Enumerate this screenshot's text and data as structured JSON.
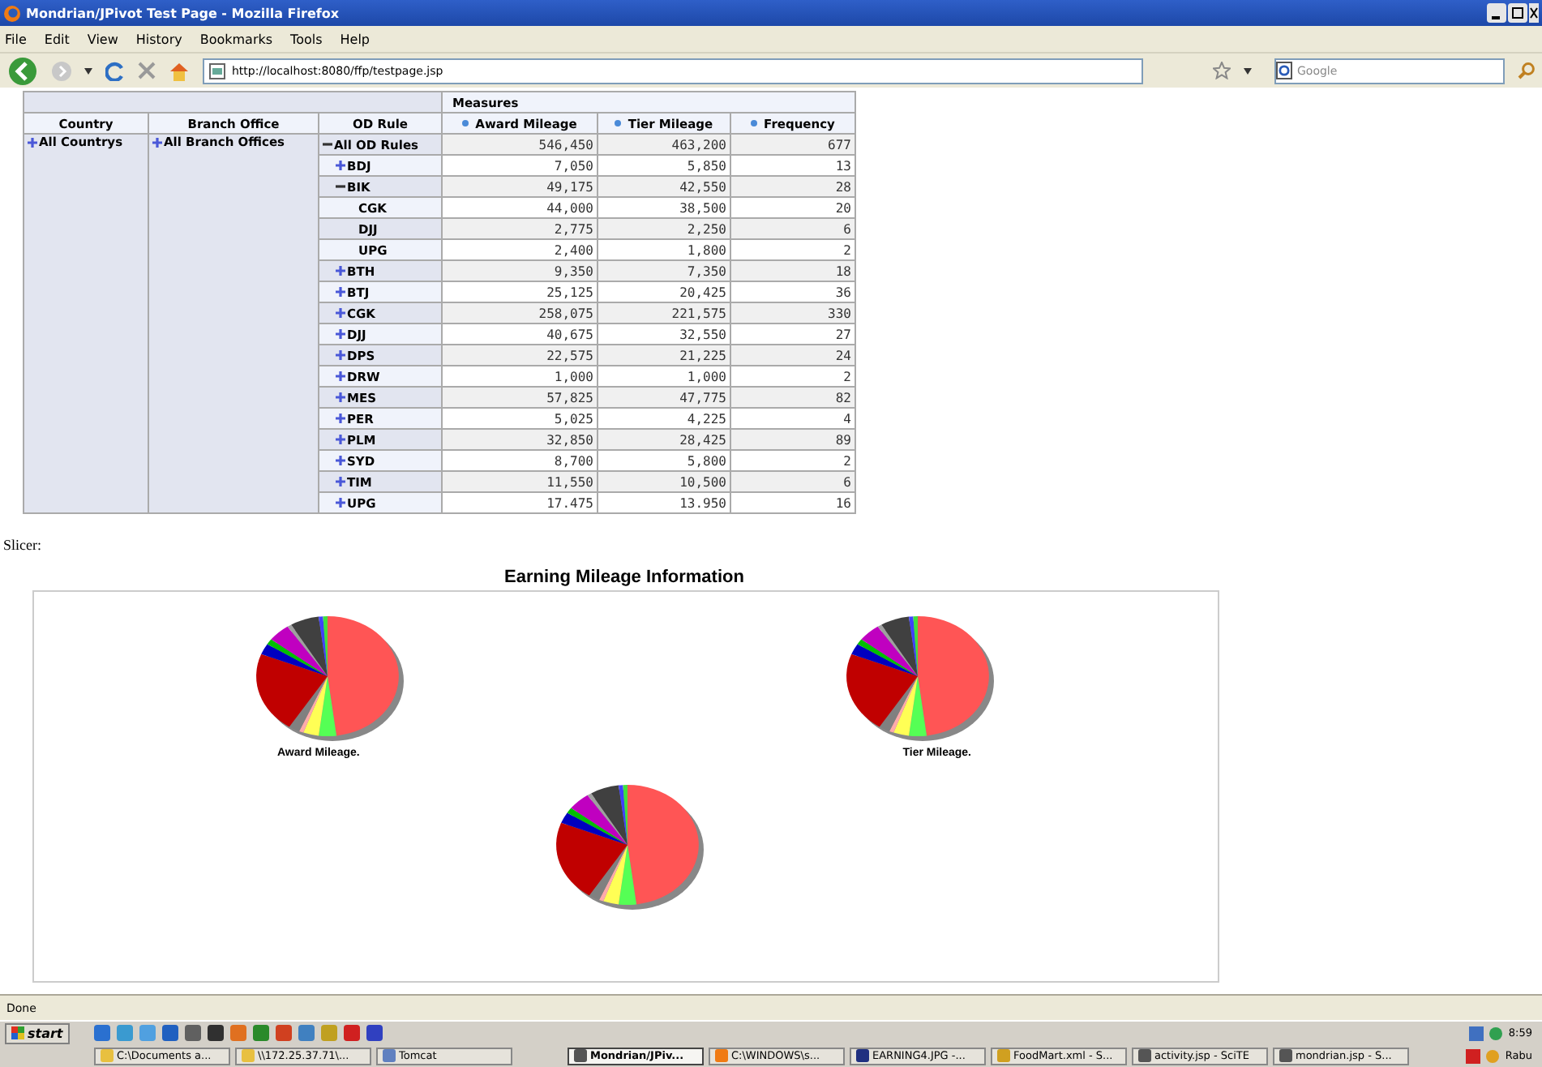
{
  "window": {
    "title": "Mondrian/JPivot Test Page - Mozilla Firefox"
  },
  "menu": [
    "File",
    "Edit",
    "View",
    "History",
    "Bookmarks",
    "Tools",
    "Help"
  ],
  "address_bar": {
    "value": "http://localhost:8080/ffp/testpage.jsp"
  },
  "search": {
    "placeholder": "Google"
  },
  "pivot": {
    "measures_label": "Measures",
    "columns": [
      "Country",
      "Branch Office",
      "OD Rule",
      "Award Mileage",
      "Tier Mileage",
      "Frequency"
    ],
    "country": {
      "label": "All Countrys",
      "expanded": false
    },
    "branch": {
      "label": "All Branch Offices",
      "expanded": false
    },
    "rows": [
      {
        "label": "All OD Rules",
        "kind": "member",
        "expanded": true,
        "values": [
          "546,450",
          "463,200",
          "677"
        ],
        "children": [
          {
            "label": "BDJ",
            "kind": "member",
            "expanded": false,
            "values": [
              "7,050",
              "5,850",
              "13"
            ]
          },
          {
            "label": "BIK",
            "kind": "member",
            "expanded": true,
            "values": [
              "49,175",
              "42,550",
              "28"
            ],
            "children": [
              {
                "label": "CGK",
                "kind": "leaf",
                "values": [
                  "44,000",
                  "38,500",
                  "20"
                ]
              },
              {
                "label": "DJJ",
                "kind": "leaf",
                "values": [
                  "2,775",
                  "2,250",
                  "6"
                ]
              },
              {
                "label": "UPG",
                "kind": "leaf",
                "values": [
                  "2,400",
                  "1,800",
                  "2"
                ]
              }
            ]
          },
          {
            "label": "BTH",
            "kind": "member",
            "expanded": false,
            "values": [
              "9,350",
              "7,350",
              "18"
            ]
          },
          {
            "label": "BTJ",
            "kind": "member",
            "expanded": false,
            "values": [
              "25,125",
              "20,425",
              "36"
            ]
          },
          {
            "label": "CGK",
            "kind": "member",
            "expanded": false,
            "values": [
              "258,075",
              "221,575",
              "330"
            ]
          },
          {
            "label": "DJJ",
            "kind": "member",
            "expanded": false,
            "values": [
              "40,675",
              "32,550",
              "27"
            ]
          },
          {
            "label": "DPS",
            "kind": "member",
            "expanded": false,
            "values": [
              "22,575",
              "21,225",
              "24"
            ]
          },
          {
            "label": "DRW",
            "kind": "member",
            "expanded": false,
            "values": [
              "1,000",
              "1,000",
              "2"
            ]
          },
          {
            "label": "MES",
            "kind": "member",
            "expanded": false,
            "values": [
              "57,825",
              "47,775",
              "82"
            ]
          },
          {
            "label": "PER",
            "kind": "member",
            "expanded": false,
            "values": [
              "5,025",
              "4,225",
              "4"
            ]
          },
          {
            "label": "PLM",
            "kind": "member",
            "expanded": false,
            "values": [
              "32,850",
              "28,425",
              "89"
            ]
          },
          {
            "label": "SYD",
            "kind": "member",
            "expanded": false,
            "values": [
              "8,700",
              "5,800",
              "2"
            ]
          },
          {
            "label": "TIM",
            "kind": "member",
            "expanded": false,
            "values": [
              "11,550",
              "10,500",
              "6"
            ]
          },
          {
            "label": "UPG",
            "kind": "member",
            "expanded": false,
            "values": [
              "17.475",
              "13.950",
              "16"
            ]
          }
        ]
      }
    ]
  },
  "slicer": "Slicer:",
  "chart": {
    "title": "Earning Mileage Information",
    "pies": [
      {
        "kind": "labeled",
        "label": "Award Mileage."
      },
      {
        "kind": "labeled",
        "label": "Tier Mileage."
      },
      {
        "kind": "unlabeled"
      }
    ]
  },
  "status_bar": "Done",
  "taskbar": {
    "start": "start",
    "tasks": [
      {
        "label": "C:\\Documents a...",
        "selected": false
      },
      {
        "label": "\\\\172.25.37.71\\...",
        "selected": false
      },
      {
        "label": "Tomcat",
        "selected": false
      },
      {
        "label": "Mondrian/JPiv...",
        "selected": true
      },
      {
        "label": "C:\\WINDOWS\\s...",
        "selected": false
      },
      {
        "label": "EARNING4.JPG -...",
        "selected": false
      },
      {
        "label": "FoodMart.xml - S...",
        "selected": false
      },
      {
        "label": "activity.jsp - SciTE",
        "selected": false
      },
      {
        "label": "mondrian.jsp - S...",
        "selected": false
      }
    ],
    "clock": "8:59",
    "day": "Rabu"
  }
}
